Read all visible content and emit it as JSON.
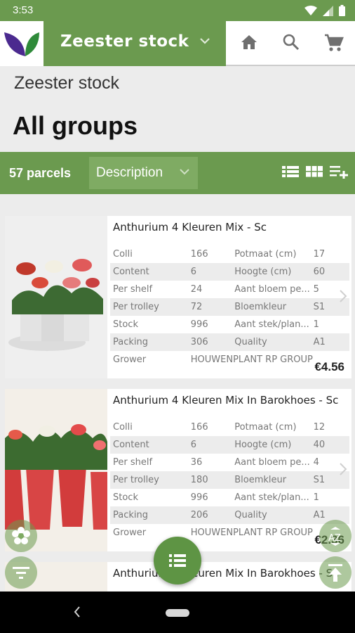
{
  "status_bar": {
    "time": "3:53"
  },
  "app_bar": {
    "title": "Zeester stock",
    "icons": [
      "home-icon",
      "search-icon",
      "cart-icon"
    ]
  },
  "page": {
    "subtitle": "Zeester stock",
    "heading": "All groups"
  },
  "filter_bar": {
    "count": "57 parcels",
    "sort_label": "Description",
    "icons": [
      "list-view-icon",
      "grid-view-icon",
      "add-to-list-icon"
    ]
  },
  "products": [
    {
      "name": "Anthurium 4 Kleuren Mix - Sc",
      "rows": [
        [
          "Colli",
          "166",
          "Potmaat (cm)",
          "17"
        ],
        [
          "Content",
          "6",
          "Hoogte (cm)",
          "60"
        ],
        [
          "Per shelf",
          "24",
          "Aant bloem pe...",
          "5"
        ],
        [
          "Per trolley",
          "72",
          "Bloemkleur",
          "S1"
        ],
        [
          "Stock",
          "996",
          "Aant stek/plan...",
          "1"
        ],
        [
          "Packing",
          "306",
          "Quality",
          "A1"
        ]
      ],
      "grower_label": "Grower",
      "grower": "HOUWENPLANT RP GROUP",
      "price": "€4.56"
    },
    {
      "name": "Anthurium 4 Kleuren Mix In Barokhoes - Sc",
      "rows": [
        [
          "Colli",
          "166",
          "Potmaat (cm)",
          "12"
        ],
        [
          "Content",
          "6",
          "Hoogte (cm)",
          "40"
        ],
        [
          "Per shelf",
          "36",
          "Aant bloem pe...",
          "4"
        ],
        [
          "Per trolley",
          "180",
          "Bloemkleur",
          "S1"
        ],
        [
          "Stock",
          "996",
          "Aant stek/plan...",
          "1"
        ],
        [
          "Packing",
          "206",
          "Quality",
          "A1"
        ]
      ],
      "grower_label": "Grower",
      "grower": "HOUWENPLANT RP GROUP",
      "price": "€2.36"
    },
    {
      "name": "Anthurium 4 Kleuren Mix In Barokhoes - Sc"
    }
  ],
  "colors": {
    "brand_green": "#6b9a4f",
    "fab_green": "#5e9444",
    "row_alt": "#ececec"
  }
}
